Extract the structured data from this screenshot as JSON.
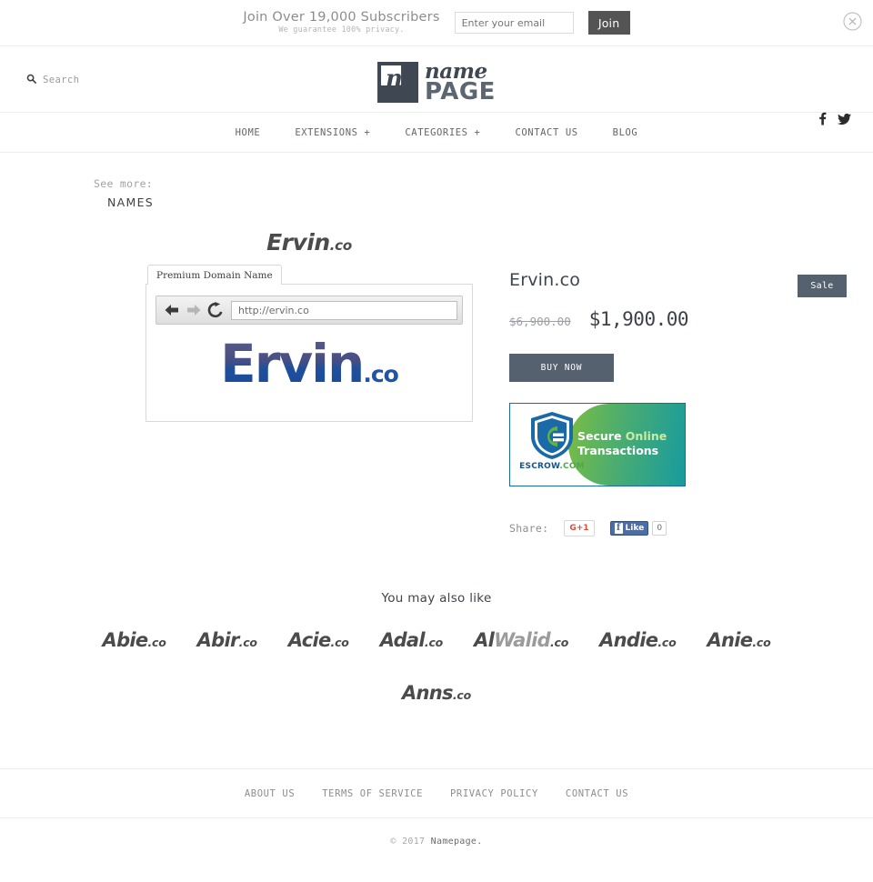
{
  "subscribe": {
    "title": "Join Over 19,000 Subscribers",
    "subtitle": "We guarantee 100% privacy.",
    "email_placeholder": "Enter your email",
    "join_label": "Join",
    "close_icon": "close-circle-icon"
  },
  "header": {
    "search_label": "Search",
    "search_icon": "search-icon",
    "logo": {
      "mark_letter": "n",
      "name": "name",
      "page": "PAGE"
    },
    "social": [
      {
        "name": "facebook-icon",
        "glyph": "f"
      },
      {
        "name": "twitter-icon",
        "glyph": "bird"
      }
    ]
  },
  "nav": {
    "items": [
      {
        "label": "HOME"
      },
      {
        "label": "EXTENSIONS +"
      },
      {
        "label": "CATEGORIES +"
      },
      {
        "label": "CONTACT US"
      },
      {
        "label": "BLOG"
      }
    ]
  },
  "breadcrumb": {
    "see_more_label": "See more:",
    "category": "NAMES"
  },
  "product": {
    "heading_name": "Ervin",
    "heading_tld": ".co",
    "sale_badge": "Sale",
    "title": "Ervin.co",
    "price_old": "$6,900.00",
    "price_new": "$1,900.00",
    "buy_label": "BUY NOW",
    "mock": {
      "tab_label": "Premium Domain Name",
      "url": "http://ervin.co",
      "back_icon": "back-arrow-icon",
      "forward_icon": "forward-arrow-icon",
      "reload_icon": "reload-icon",
      "hero_name": "Ervin",
      "hero_tld": ".co"
    },
    "escrow": {
      "brand_main": "ESCROW",
      "brand_tld": ".COM",
      "line1_plain": "Secure ",
      "line1_accent": "Online",
      "line2": "Transactions",
      "shield_icon": "escrow-shield-icon",
      "accent_color": "#51a848",
      "brand_color": "#14558f"
    },
    "share": {
      "label": "Share:",
      "gplus_label": "G+1",
      "facebook_like_label": "Like",
      "facebook_f": "f",
      "count": "0"
    }
  },
  "also_like": {
    "title": "You may also like",
    "items": [
      {
        "name": "Abie",
        "tld": ".co"
      },
      {
        "name": "Abir",
        "tld": ".co"
      },
      {
        "name": "Acie",
        "tld": ".co"
      },
      {
        "name": "Adal",
        "tld": ".co"
      },
      {
        "name": "Al",
        "name_light": "Walid",
        "tld": ".co"
      },
      {
        "name": "Andie",
        "tld": ".co"
      },
      {
        "name": "Anie",
        "tld": ".co"
      }
    ],
    "items_row2": [
      {
        "name": "Anns",
        "tld": ".co"
      }
    ]
  },
  "footer": {
    "links": [
      {
        "label": "ABOUT US"
      },
      {
        "label": "TERMS OF SERVICE"
      },
      {
        "label": "PRIVACY POLICY"
      },
      {
        "label": "CONTACT US"
      }
    ],
    "copyright_prefix": "© 2017 ",
    "copyright_brand": "Namepage."
  },
  "colors": {
    "accent_dark": "#56616f",
    "text": "#4a4a4a",
    "muted": "#8d8d8d"
  }
}
